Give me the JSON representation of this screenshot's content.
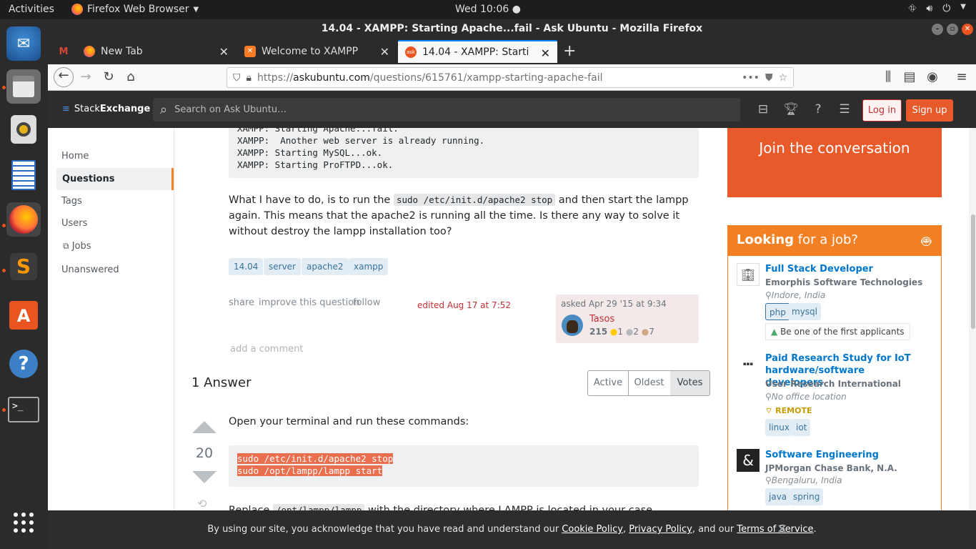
{
  "system": {
    "activities": "Activities",
    "app_name": "Firefox Web Browser",
    "clock": "Wed 10:06"
  },
  "window": {
    "title": "14.04 - XAMPP: Starting Apache...fail - Ask Ubuntu - Mozilla Firefox"
  },
  "tabs": [
    {
      "label": "New Tab"
    },
    {
      "label": "Welcome to XAMPP"
    },
    {
      "label": "14.04 - XAMPP: Starting Apache...fail"
    }
  ],
  "url": {
    "prefix": "https://",
    "host": "askubuntu.com",
    "path": "/questions/615761/xampp-starting-apache-fail"
  },
  "se_header": {
    "logo_stack": "Stack",
    "logo_exchange": "Exchange",
    "search_placeholder": "Search on Ask Ubuntu…",
    "login": "Log in",
    "signup": "Sign up"
  },
  "left_nav": {
    "home": "Home",
    "questions": "Questions",
    "tags": "Tags",
    "users": "Users",
    "jobs": "Jobs",
    "unanswered": "Unanswered"
  },
  "question": {
    "code_lines": "XAMPP: Starting Apache...fail.\nXAMPP:  Another web server is already running.\nXAMPP: Starting MySQL...ok.\nXAMPP: Starting ProFTPD...ok.",
    "para_before": "What I have to do, is to run the ",
    "para_code": "sudo /etc/init.d/apache2 stop",
    "para_after": " and then start the lampp again. This means that the apache2 is running all the time. Is there any way to solve it without destroy the lampp installation too?",
    "tags": [
      "14.04",
      "server",
      "apache2",
      "xampp"
    ],
    "share": "share",
    "improve": "improve this question",
    "follow": "follow",
    "edited": "edited Aug 17 at 7:52",
    "asked": "asked Apr 29 '15 at 9:34",
    "user": "Tasos",
    "rep": "215",
    "gold": "1",
    "silver": "2",
    "bronze": "7",
    "add_comment": "add a comment"
  },
  "answers": {
    "count_label": "1 Answer",
    "sort_active": "Active",
    "sort_oldest": "Oldest",
    "sort_votes": "Votes",
    "intro": "Open your terminal and run these commands:",
    "vote_count": "20",
    "code_lines": "sudo /etc/init.d/apache2 stop\nsudo /opt/lampp/lampp start",
    "replace_before": "Replace ",
    "replace_code": "/opt/lampp/lampp",
    "replace_after": " with the directory where LAMPP is located in your case."
  },
  "sidebar": {
    "join": "Join the conversation",
    "jobs_head_bold": "Looking",
    "jobs_head_rest": " for a job?",
    "jobs": [
      {
        "title": "Full Stack Developer",
        "company": "Emorphis Software Technologies",
        "location": "Indore, India",
        "tags": [
          "php",
          "mysql"
        ],
        "note": "Be one of the first applicants"
      },
      {
        "title": "Paid Research Study for IoT hardware/software developers",
        "company": "User Research International",
        "location": "No office location",
        "remote": "REMOTE",
        "tags": [
          "linux",
          "iot"
        ]
      },
      {
        "title": "Software Engineering",
        "company": "JPMorgan Chase Bank, N.A.",
        "location": "Bengaluru, India",
        "tags": [
          "java",
          "spring"
        ]
      }
    ]
  },
  "cookie": {
    "before": "By using our site, you acknowledge that you have read and understand our ",
    "cookie_policy": "Cookie Policy",
    "sep1": ", ",
    "privacy_policy": "Privacy Policy",
    "sep2": ", and our ",
    "terms": "Terms of Service",
    "end": "."
  },
  "colors": {
    "accent": "#f48024",
    "se_orange": "#e85a2a",
    "link": "#0077cc",
    "tag_bg": "#e1ecf4"
  }
}
